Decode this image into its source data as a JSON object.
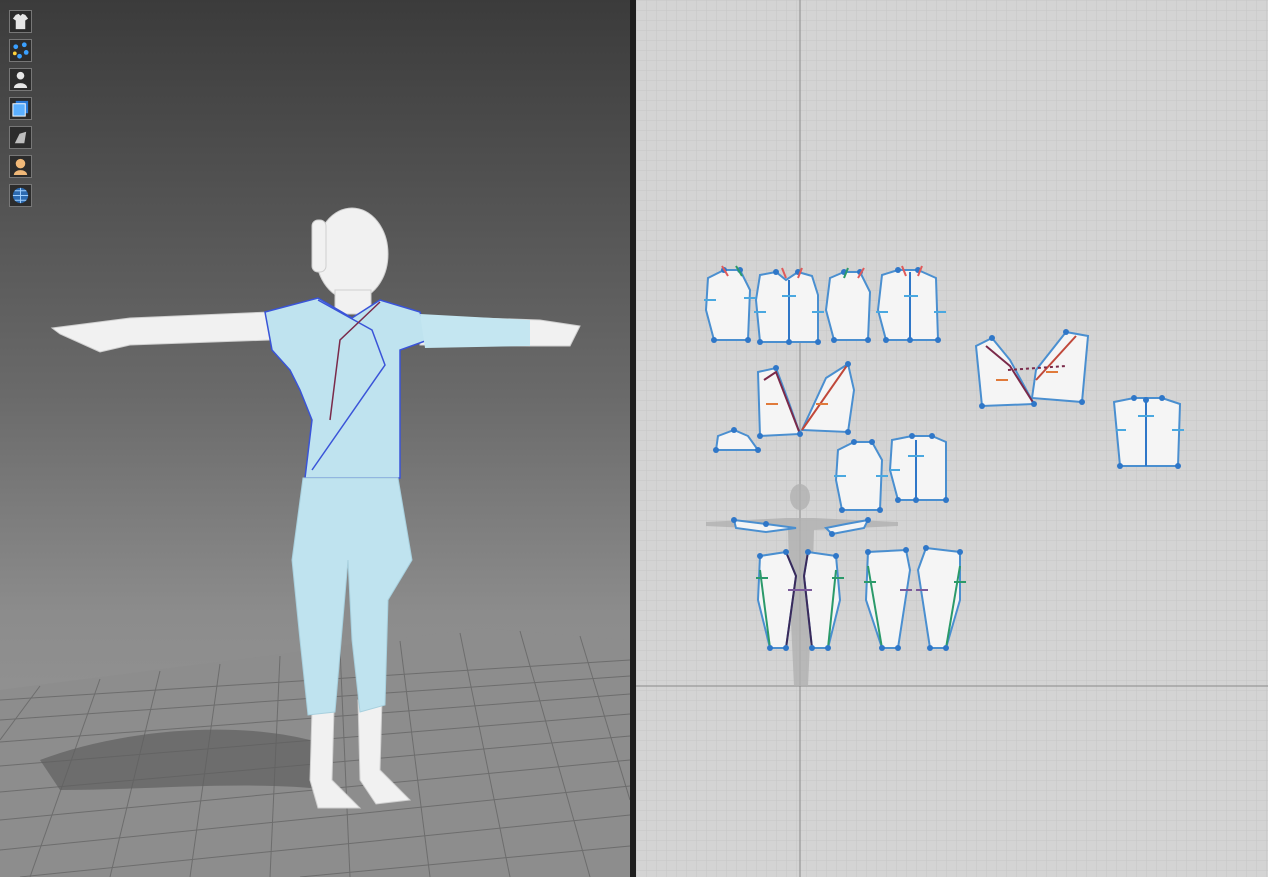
{
  "app": {
    "name": ""
  },
  "viewport_3d": {
    "toolbar": [
      {
        "icon": "garment-display-icon"
      },
      {
        "icon": "point-display-icon"
      },
      {
        "icon": "avatar-display-icon"
      },
      {
        "icon": "texture-display-icon"
      },
      {
        "icon": "shading-display-icon"
      },
      {
        "icon": "avatar-skin-icon"
      },
      {
        "icon": "environment-display-icon"
      }
    ],
    "colors": {
      "garment": "#bfe3ef",
      "avatar": "#f2f2f2",
      "seam": "#3a54d8",
      "floor_grid": "#6f6f6f"
    }
  },
  "viewport_2d": {
    "colors": {
      "background": "#d4d4d4",
      "grid": "#c6c6c6",
      "axis": "#8a8a8a",
      "pattern_fill": "#f5f5f5",
      "pattern_outline": "#4a8fd0",
      "point": "#2f77c8"
    }
  }
}
